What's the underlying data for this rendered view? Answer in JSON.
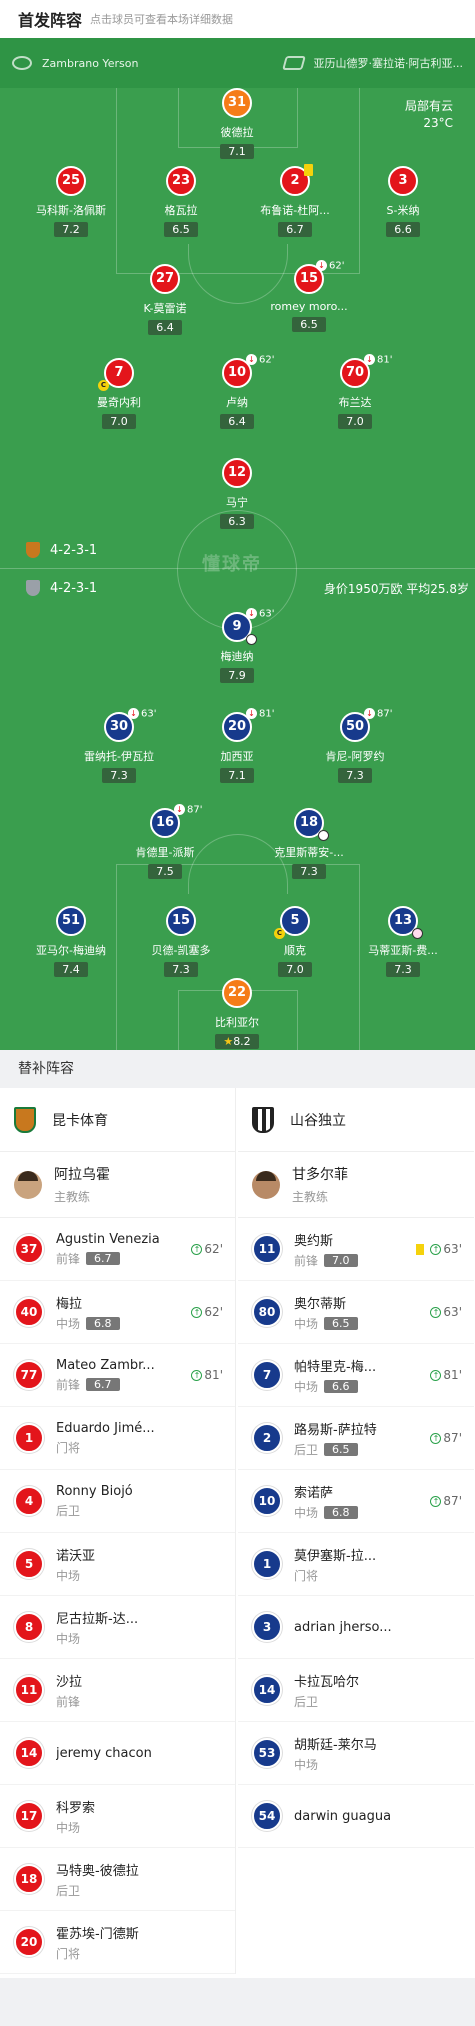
{
  "header": {
    "title": "首发阵容",
    "subtitle": "点击球员可查看本场详细数据"
  },
  "pitch": {
    "home_coach": "Zambrano Yerson",
    "away_coach": "亚历山德罗·塞拉诺·阿古利亚...",
    "weather": "局部有云",
    "temperature": "23°C",
    "home_formation": "4-2-3-1",
    "away_formation": "4-2-3-1",
    "value_info": "身价1950万欧  平均25.8岁",
    "watermark": "懂球帝",
    "home_players": [
      {
        "num": "31",
        "name": "彼德拉",
        "rate": "7.1"
      },
      {
        "num": "25",
        "name": "马科斯-洛佩斯",
        "rate": "7.2"
      },
      {
        "num": "23",
        "name": "格瓦拉",
        "rate": "6.5"
      },
      {
        "num": "2",
        "name": "布鲁诺-杜阿...",
        "rate": "6.7"
      },
      {
        "num": "3",
        "name": "S-米纳",
        "rate": "6.6"
      },
      {
        "num": "27",
        "name": "K-莫雷诺",
        "rate": "6.4"
      },
      {
        "num": "15",
        "name": "romey moro...",
        "rate": "6.5",
        "sub": "62'"
      },
      {
        "num": "7",
        "name": "曼奇内利",
        "rate": "7.0"
      },
      {
        "num": "10",
        "name": "卢纳",
        "rate": "6.4",
        "sub": "62'"
      },
      {
        "num": "70",
        "name": "布兰达",
        "rate": "7.0",
        "sub": "81'"
      },
      {
        "num": "12",
        "name": "马宁",
        "rate": "6.3"
      }
    ],
    "away_players": [
      {
        "num": "9",
        "name": "梅迪纳",
        "rate": "7.9",
        "sub": "63'"
      },
      {
        "num": "30",
        "name": "雷纳托-伊瓦拉",
        "rate": "7.3",
        "sub": "63'"
      },
      {
        "num": "20",
        "name": "加西亚",
        "rate": "7.1",
        "sub": "81'"
      },
      {
        "num": "50",
        "name": "肯尼-阿罗约",
        "rate": "7.3",
        "sub": "87'"
      },
      {
        "num": "16",
        "name": "肯德里-派斯",
        "rate": "7.5",
        "sub": "87'"
      },
      {
        "num": "18",
        "name": "克里斯蒂安-...",
        "rate": "7.3"
      },
      {
        "num": "51",
        "name": "亚马尔-梅迪纳",
        "rate": "7.4"
      },
      {
        "num": "15",
        "name": "贝德-凯塞多",
        "rate": "7.3"
      },
      {
        "num": "5",
        "name": "顺克",
        "rate": "7.0"
      },
      {
        "num": "13",
        "name": "马蒂亚斯-费...",
        "rate": "7.3"
      },
      {
        "num": "22",
        "name": "比利亚尔",
        "rate": "8.2"
      }
    ]
  },
  "subs": {
    "title": "替补阵容",
    "home": {
      "team": "昆卡体育",
      "coach": {
        "name": "阿拉乌霍",
        "role": "主教练"
      },
      "players": [
        {
          "num": "37",
          "name": "Agustin Venezia",
          "pos": "前锋",
          "rate": "6.7",
          "time": "62'"
        },
        {
          "num": "40",
          "name": "梅拉",
          "pos": "中场",
          "rate": "6.8",
          "time": "62'"
        },
        {
          "num": "77",
          "name": "Mateo Zambr...",
          "pos": "前锋",
          "rate": "6.7",
          "time": "81'"
        },
        {
          "num": "1",
          "name": "Eduardo Jimé...",
          "pos": "门将"
        },
        {
          "num": "4",
          "name": "Ronny Biojó",
          "pos": "后卫"
        },
        {
          "num": "5",
          "name": "诺沃亚",
          "pos": "中场"
        },
        {
          "num": "8",
          "name": "尼古拉斯-达...",
          "pos": "中场"
        },
        {
          "num": "11",
          "name": "沙拉",
          "pos": "前锋"
        },
        {
          "num": "14",
          "name": "jeremy chacon",
          "pos": ""
        },
        {
          "num": "17",
          "name": "科罗索",
          "pos": "中场"
        },
        {
          "num": "18",
          "name": "马特奥-彼德拉",
          "pos": "后卫"
        },
        {
          "num": "20",
          "name": "霍苏埃-门德斯",
          "pos": "门将"
        }
      ]
    },
    "away": {
      "team": "山谷独立",
      "coach": {
        "name": "甘多尔菲",
        "role": "主教练"
      },
      "players": [
        {
          "num": "11",
          "name": "奥约斯",
          "pos": "前锋",
          "rate": "7.0",
          "time": "63'",
          "card": true
        },
        {
          "num": "80",
          "name": "奥尔蒂斯",
          "pos": "中场",
          "rate": "6.5",
          "time": "63'"
        },
        {
          "num": "7",
          "name": "帕特里克-梅...",
          "pos": "中场",
          "rate": "6.6",
          "time": "81'"
        },
        {
          "num": "2",
          "name": "路易斯-萨拉特",
          "pos": "后卫",
          "rate": "6.5",
          "time": "87'"
        },
        {
          "num": "10",
          "name": "索诺萨",
          "pos": "中场",
          "rate": "6.8",
          "time": "87'"
        },
        {
          "num": "1",
          "name": "莫伊塞斯-拉...",
          "pos": "门将"
        },
        {
          "num": "3",
          "name": "adrian jherso...",
          "pos": ""
        },
        {
          "num": "14",
          "name": "卡拉瓦哈尔",
          "pos": "后卫"
        },
        {
          "num": "53",
          "name": "胡斯廷-莱尔马",
          "pos": "中场"
        },
        {
          "num": "54",
          "name": "darwin guagua",
          "pos": ""
        }
      ]
    }
  },
  "colors": {
    "pitch": "#3a9e4e",
    "home": "#e3151b",
    "away": "#173a8c",
    "keeper_home": "#f57c18"
  }
}
